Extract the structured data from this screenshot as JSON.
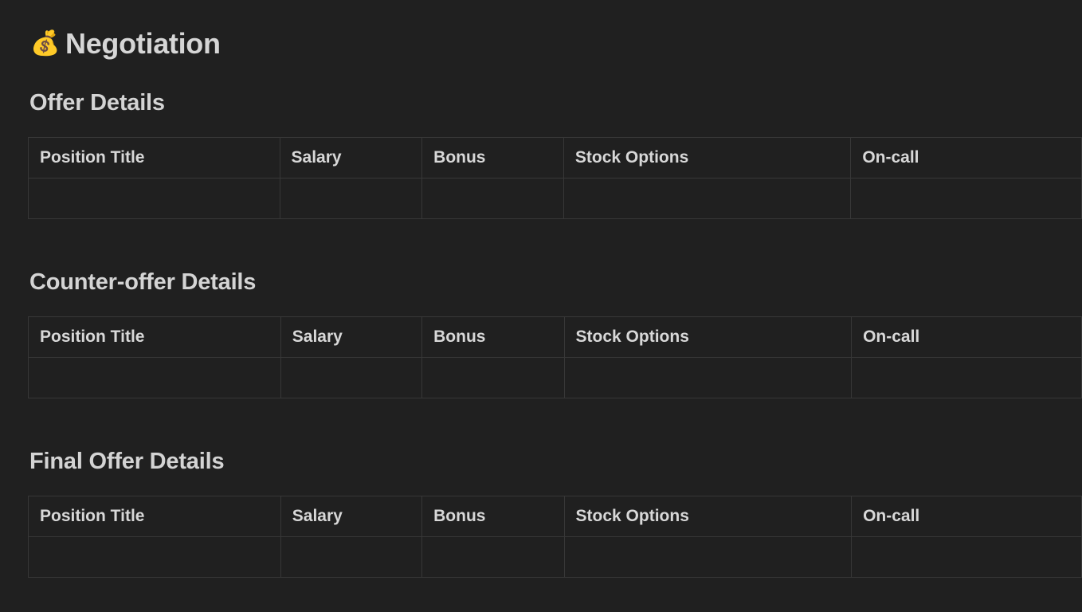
{
  "page": {
    "icon": "money-bag-icon",
    "icon_glyph": "💰",
    "title": "Negotiation"
  },
  "sections": [
    {
      "heading": "Offer Details",
      "columns": [
        "Position Title",
        "Salary",
        "Bonus",
        "Stock Options",
        "On-call"
      ],
      "rows": [
        [
          "",
          "",
          "",
          "",
          ""
        ]
      ]
    },
    {
      "heading": "Counter-offer Details",
      "columns": [
        "Position Title",
        "Salary",
        "Bonus",
        "Stock Options",
        "On-call"
      ],
      "rows": [
        [
          "",
          "",
          "",
          "",
          ""
        ]
      ]
    },
    {
      "heading": "Final Offer Details",
      "columns": [
        "Position Title",
        "Salary",
        "Bonus",
        "Stock Options",
        "On-call"
      ],
      "rows": [
        [
          "",
          "",
          "",
          "",
          ""
        ]
      ]
    }
  ],
  "colors": {
    "background": "#202020",
    "text": "#d4d4d4",
    "border": "#373737"
  }
}
